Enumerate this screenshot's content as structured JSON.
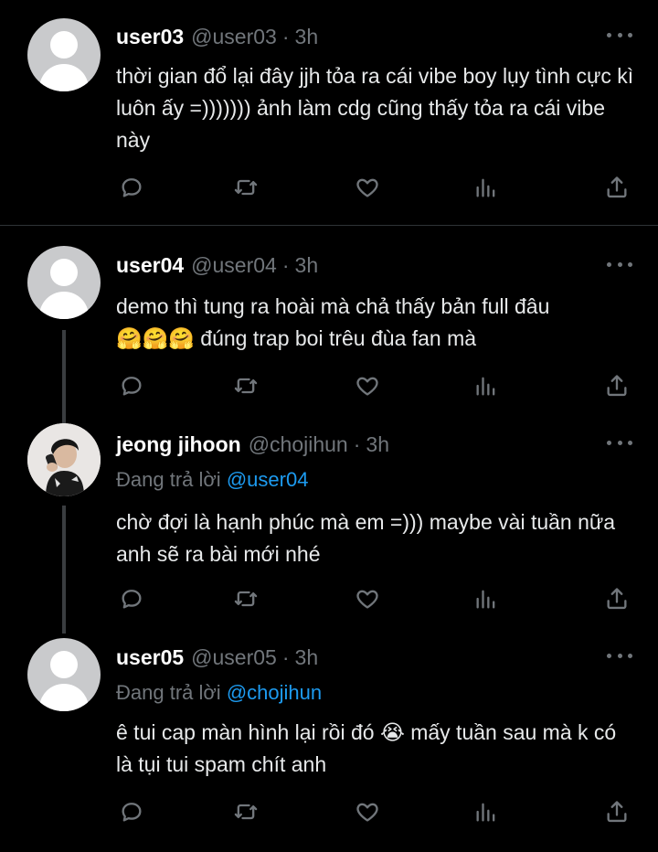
{
  "tweets": [
    {
      "name": "user03",
      "handle": "@user03",
      "dot": "·",
      "time": "3h",
      "avatar": "default-avatar",
      "text": "thời gian đổ lại đây jjh tỏa ra cái vibe boy lụy tình cực kì luôn ấy =))))))) ảnh làm cdg cũng thấy tỏa ra cái vibe này"
    },
    {
      "name": "user04",
      "handle": "@user04",
      "dot": "·",
      "time": "3h",
      "avatar": "default-avatar",
      "text_line1": "demo thì tung ra hoài mà chả thấy bản full đâu",
      "text_line2": "🤗🤗🤗 đúng trap boi trêu đùa fan mà"
    },
    {
      "name": "jeong jihoon",
      "handle": "@chojihun",
      "dot": "·",
      "time": "3h",
      "avatar": "profile-photo",
      "reply_prefix": "Đang trả lời",
      "reply_mention": "@user04",
      "text": "chờ đợi là hạnh phúc mà em =))) maybe vài tuần nữa anh sẽ ra bài mới nhé"
    },
    {
      "name": "user05",
      "handle": "@user05",
      "dot": "·",
      "time": "3h",
      "avatar": "default-avatar",
      "reply_prefix": "Đang trả lời",
      "reply_mention": "@chojihun",
      "text": "ê tui cap màn hình lại rồi đó 😭 mấy tuần sau mà k có là tụi tui spam chít anh"
    }
  ],
  "icons": {
    "reply": "reply-icon",
    "retweet": "retweet-icon",
    "like": "like-icon",
    "views": "views-icon",
    "share": "share-icon",
    "more": "more-icon"
  },
  "colors": {
    "background": "#000000",
    "text": "#e7e9ea",
    "secondary": "#71767b",
    "mention": "#1d9bf0",
    "divider": "#2f3336"
  }
}
